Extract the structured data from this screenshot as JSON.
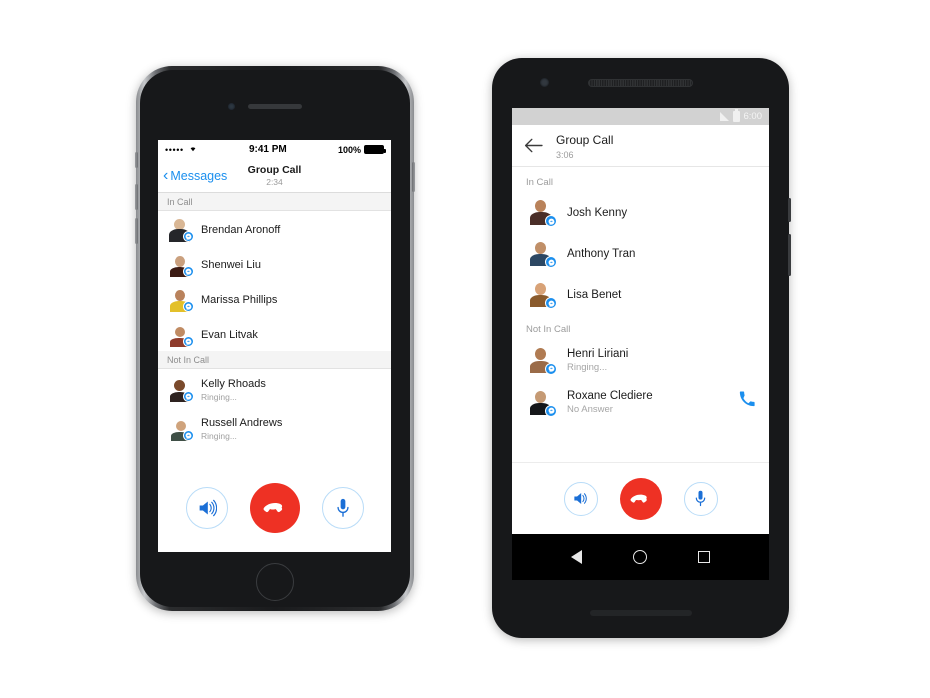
{
  "scene": {
    "description": "Facebook Messenger group call screens on iPhone and Android",
    "accent_blue": "#1b8fee",
    "hangup_red": "#ee3124"
  },
  "iphone": {
    "status_bar": {
      "signal_dots": "•••••",
      "wifi_icon": "wifi-icon",
      "time": "9:41 PM",
      "battery_percent": "100%",
      "battery_icon": "battery-full-icon"
    },
    "nav": {
      "back_icon": "chevron-left-icon",
      "back_label": "Messages",
      "title": "Group Call",
      "subtitle": "2:34"
    },
    "sections": [
      {
        "header": "In Call",
        "rows": [
          {
            "name": "Brendan Aronoff",
            "status": "",
            "avatar": "brendan",
            "badge": "messenger-badge-icon"
          },
          {
            "name": "Shenwei Liu",
            "status": "",
            "avatar": "shenwei",
            "badge": "messenger-badge-icon"
          },
          {
            "name": "Marissa Phillips",
            "status": "",
            "avatar": "marissa",
            "badge": "messenger-badge-icon"
          },
          {
            "name": "Evan Litvak",
            "status": "",
            "avatar": "evan",
            "badge": "messenger-badge-icon"
          }
        ]
      },
      {
        "header": "Not In Call",
        "rows": [
          {
            "name": "Kelly Rhoads",
            "status": "Ringing...",
            "avatar": "kelly",
            "badge": "messenger-badge-icon"
          },
          {
            "name": "Russell Andrews",
            "status": "Ringing...",
            "avatar": "russell",
            "badge": "messenger-badge-icon"
          }
        ]
      }
    ],
    "controls": [
      {
        "id": "speaker",
        "icon": "speaker-icon",
        "style": "outline"
      },
      {
        "id": "hangup",
        "icon": "hangup-phone-icon",
        "style": "filled-red"
      },
      {
        "id": "mute",
        "icon": "microphone-icon",
        "style": "outline"
      }
    ]
  },
  "android": {
    "status_bar": {
      "signal_icon": "signal-bars-icon",
      "battery_icon": "battery-icon",
      "time": "6:00"
    },
    "appbar": {
      "back_icon": "arrow-left-icon",
      "title": "Group Call",
      "subtitle": "3:06"
    },
    "sections": [
      {
        "header": "In Call",
        "rows": [
          {
            "name": "Josh Kenny",
            "status": "",
            "avatar": "josh",
            "badge": "messenger-badge-icon",
            "action": ""
          },
          {
            "name": "Anthony Tran",
            "status": "",
            "avatar": "anthony",
            "badge": "messenger-badge-icon",
            "action": ""
          },
          {
            "name": "Lisa Benet",
            "status": "",
            "avatar": "lisa",
            "badge": "messenger-badge-icon",
            "action": ""
          }
        ]
      },
      {
        "header": "Not In Call",
        "rows": [
          {
            "name": "Henri Liriani",
            "status": "Ringing...",
            "avatar": "henri",
            "badge": "messenger-badge-icon",
            "action": ""
          },
          {
            "name": "Roxane Clediere",
            "status": "No Answer",
            "avatar": "roxane",
            "badge": "messenger-badge-icon",
            "action": "call-back-icon"
          }
        ]
      }
    ],
    "controls": [
      {
        "id": "speaker",
        "icon": "speaker-icon",
        "style": "outline"
      },
      {
        "id": "hangup",
        "icon": "hangup-phone-icon",
        "style": "filled-red"
      },
      {
        "id": "mute",
        "icon": "microphone-icon",
        "style": "outline"
      }
    ],
    "navbar": [
      {
        "id": "back",
        "icon": "nav-back-triangle-icon"
      },
      {
        "id": "home",
        "icon": "nav-home-circle-icon"
      },
      {
        "id": "recents",
        "icon": "nav-recents-square-icon"
      }
    ]
  }
}
